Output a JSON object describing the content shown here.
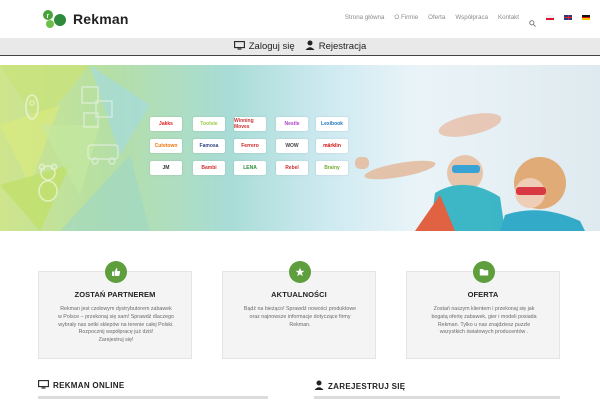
{
  "brand": {
    "name": "Rekman"
  },
  "nav": {
    "items": [
      "Strona główna",
      "O Firmie",
      "Oferta",
      "Współpraca",
      "Kontakt"
    ],
    "search_icon": "search-icon",
    "flags": [
      "pl-flag",
      "gb-flag",
      "de-flag"
    ]
  },
  "account": {
    "login_label": "Zaloguj się",
    "register_label": "Rejestracja"
  },
  "hero": {
    "brands": [
      "Jakks",
      "Tootsie",
      "Winning Moves",
      "Nestle",
      "Lexibook",
      "Cutetown",
      "Famosa",
      "Ferrero",
      "WOW",
      "märklin",
      "JM",
      "Bambi",
      "LENA",
      "Rebel",
      "Brainy"
    ]
  },
  "cards": [
    {
      "title": "ZOSTAŃ PARTNEREM",
      "icon": "thumbs-up-icon",
      "lines": [
        "Rekman jest czołowym dystrybutorem zabawek",
        "w Polsce – przekonaj się sam! Sprawdź dlaczego",
        "wybrały nas setki sklepów na terenie całej Polski.",
        "Rozpocznij współpracę już dziś!",
        "Zarejestruj się!"
      ]
    },
    {
      "title": "AKTUALNOŚCI",
      "icon": "star-icon",
      "lines": [
        "Bądź na bieżąco! Sprawdź nowości produktowe",
        "oraz najnowsze informacje dotyczące firmy",
        "Rekman."
      ]
    },
    {
      "title": "OFERTA",
      "icon": "folder-icon",
      "lines": [
        "Zostań naszym klientem i przekonaj się jak",
        "bogatą ofertę zabawek, gier i modeli posiada",
        "Rekman. Tylko u nas znajdziesz puzzle",
        "wszystkich światowych producentów ."
      ]
    }
  ],
  "bottom": {
    "left_title": "REKMAN ONLINE",
    "right_title": "ZAREJESTRUJ SIĘ"
  },
  "colors": {
    "accent": "#5e9e3d"
  }
}
